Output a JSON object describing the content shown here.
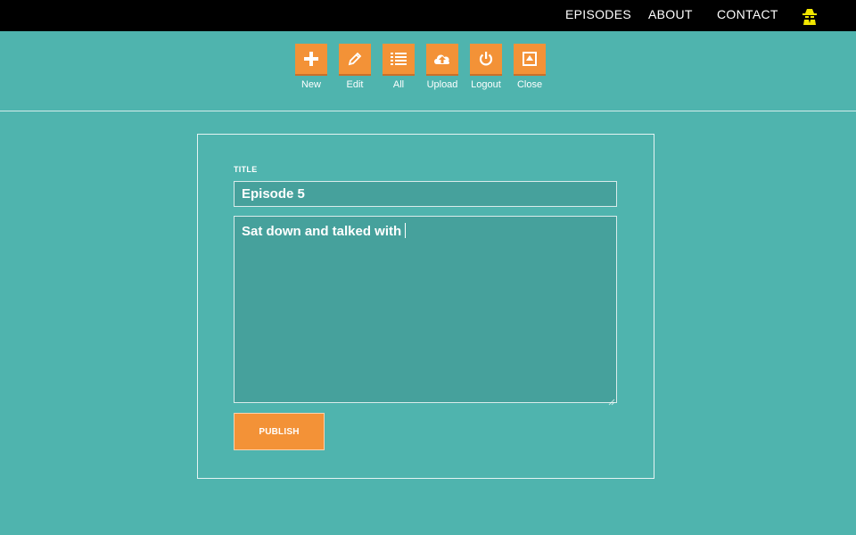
{
  "nav": {
    "items": [
      {
        "label": "EPISODES"
      },
      {
        "label": "ABOUT"
      },
      {
        "label": "CONTACT"
      }
    ],
    "profile_icon": "spy-icon"
  },
  "toolbar": {
    "items": [
      {
        "label": "New",
        "icon": "plus-icon"
      },
      {
        "label": "Edit",
        "icon": "pencil-icon"
      },
      {
        "label": "All",
        "icon": "list-icon"
      },
      {
        "label": "Upload",
        "icon": "cloud-upload-icon"
      },
      {
        "label": "Logout",
        "icon": "power-icon"
      },
      {
        "label": "Close",
        "icon": "eject-icon"
      }
    ]
  },
  "form": {
    "title_label": "TITLE",
    "title_value": "Episode 5",
    "body_value": "Sat down and talked with",
    "publish_label": "PUBLISH"
  },
  "colors": {
    "background": "#4fb4ae",
    "topbar": "#000000",
    "accent": "#f39237",
    "field": "#46a19c"
  }
}
